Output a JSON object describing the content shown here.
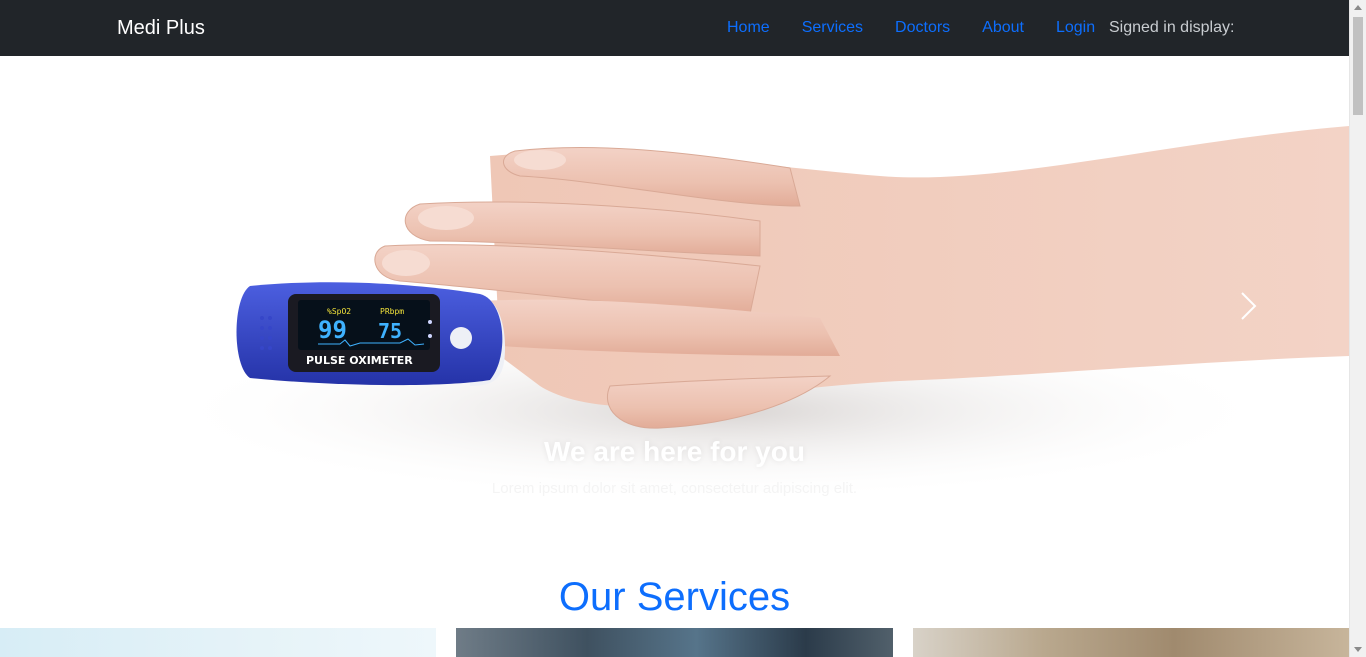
{
  "navbar": {
    "brand": "Medi Plus",
    "links": [
      "Home",
      "Services",
      "Doctors",
      "About",
      "Login"
    ],
    "signed_in": "Signed in display:"
  },
  "carousel": {
    "caption_title": "We are here for you",
    "caption_text": "Lorem ipsum dolor sit amet, consectetur adipiscing elit.",
    "device": {
      "spo2_label": "%SpO2",
      "spo2_value": "99",
      "pr_label": "PRbpm",
      "pr_value": "75",
      "name": "PULSE OXIMETER"
    }
  },
  "services": {
    "title": "Our Services"
  },
  "colors": {
    "navbar_bg": "#212529",
    "link": "#0d6efd",
    "accent": "#0d6efd",
    "device_blue": "#2f3fc4"
  }
}
